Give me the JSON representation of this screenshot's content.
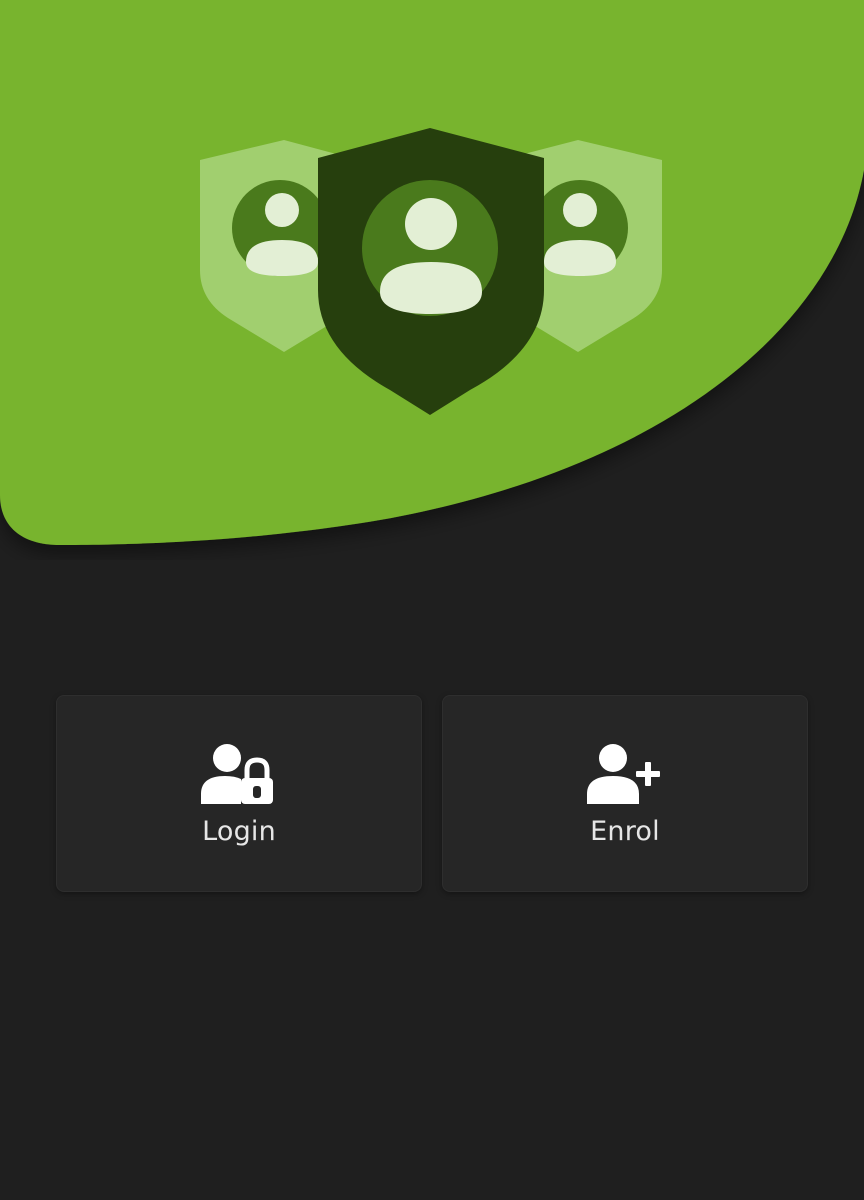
{
  "colors": {
    "background": "#1f1f1f",
    "accent_green": "#78b42e",
    "shield_dark": "#263f0d",
    "shield_light": "#a8d37a",
    "button_bg": "#262626",
    "label_text": "#e6e6e6"
  },
  "hero": {
    "icon": "security-shields-users-icon"
  },
  "actions": [
    {
      "label": "Login",
      "icon": "user-lock-icon"
    },
    {
      "label": "Enrol",
      "icon": "user-plus-icon"
    }
  ]
}
